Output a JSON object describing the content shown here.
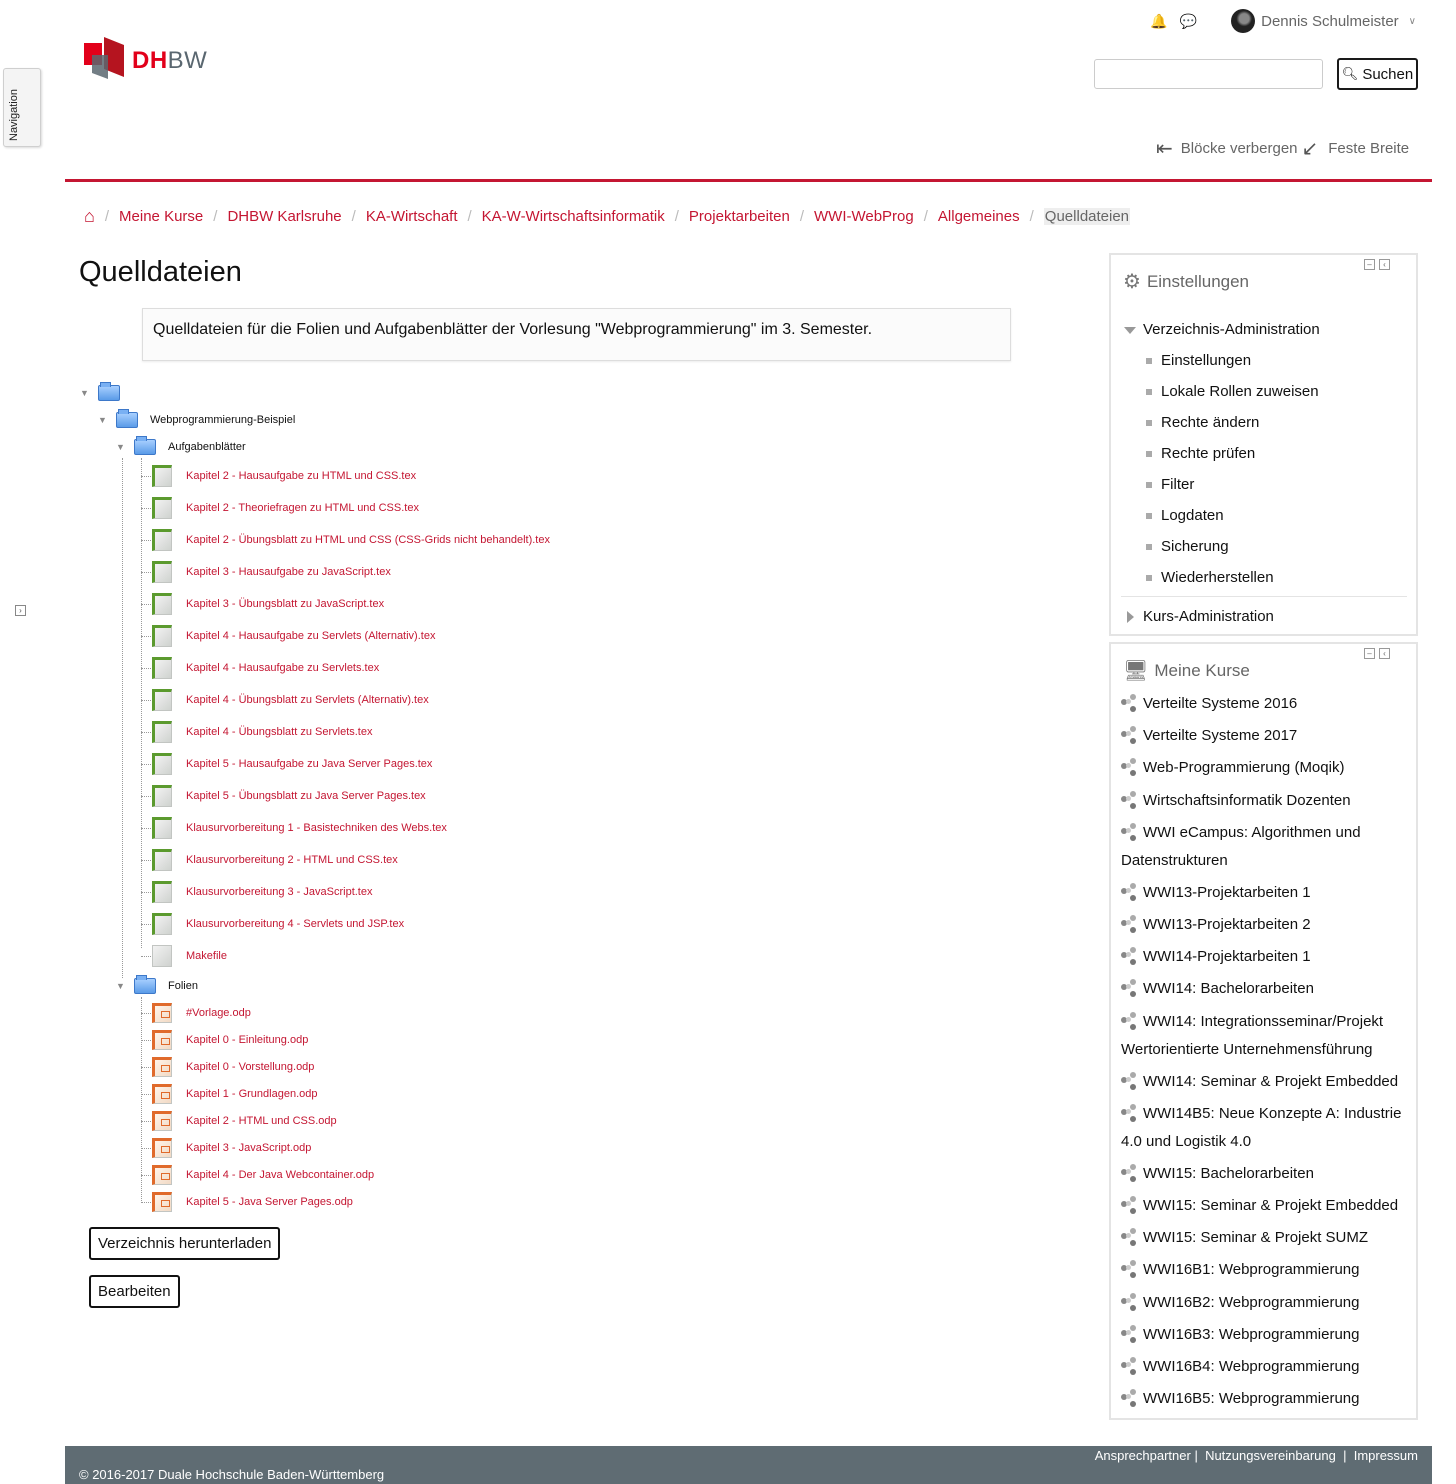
{
  "navigation_tab": {
    "label": "Navigation"
  },
  "logo": {
    "part1": "DH",
    "part2": "BW"
  },
  "topbar": {
    "notification_icon": "bell-icon",
    "messages_icon": "comments-icon",
    "user_name": "Dennis Schulmeister"
  },
  "search": {
    "placeholder": "",
    "button_label": "Suchen"
  },
  "header_tools": {
    "hide_blocks": "Blöcke verbergen",
    "fixed_width": "Feste Breite"
  },
  "breadcrumb": {
    "items": [
      "Meine Kurse",
      "DHBW Karlsruhe",
      "KA-Wirtschaft",
      "KA-W-Wirtschaftsinformatik",
      "Projektarbeiten",
      "WWI-WebProg",
      "Allgemeines"
    ],
    "current": "Quelldateien"
  },
  "page": {
    "title": "Quelldateien",
    "description": "Quelldateien für die Folien und Aufgabenblätter der Vorlesung \"Webprogrammierung\" im 3. Semester."
  },
  "tree": {
    "root_label": "",
    "folder1": "Webprogrammierung-Beispiel",
    "folder2": "Aufgabenblätter",
    "folder2_files": [
      "Kapitel 2 - Hausaufgabe zu HTML und CSS.tex",
      "Kapitel 2 - Theoriefragen zu HTML und CSS.tex",
      "Kapitel 2 - Übungsblatt zu HTML und CSS (CSS-Grids nicht behandelt).tex",
      "Kapitel 3 - Hausaufgabe zu JavaScript.tex",
      "Kapitel 3 - Übungsblatt zu JavaScript.tex",
      "Kapitel 4 - Hausaufgabe zu Servlets (Alternativ).tex",
      "Kapitel 4 - Hausaufgabe zu Servlets.tex",
      "Kapitel 4 - Übungsblatt zu Servlets (Alternativ).tex",
      "Kapitel 4 - Übungsblatt zu Servlets.tex",
      "Kapitel 5 - Hausaufgabe zu Java Server Pages.tex",
      "Kapitel 5 - Übungsblatt zu Java Server Pages.tex",
      "Klausurvorbereitung 1 - Basistechniken des Webs.tex",
      "Klausurvorbereitung 2 - HTML und CSS.tex",
      "Klausurvorbereitung 3 - JavaScript.tex",
      "Klausurvorbereitung 4 - Servlets und JSP.tex",
      "Makefile"
    ],
    "folder3": "Folien",
    "folder3_files": [
      "#Vorlage.odp",
      "Kapitel 0 - Einleitung.odp",
      "Kapitel 0 - Vorstellung.odp",
      "Kapitel 1 - Grundlagen.odp",
      "Kapitel 2 - HTML und CSS.odp",
      "Kapitel 3 - JavaScript.odp",
      "Kapitel 4 - Der Java Webcontainer.odp",
      "Kapitel 5 - Java Server Pages.odp"
    ]
  },
  "buttons": {
    "download": "Verzeichnis herunterladen",
    "edit": "Bearbeiten"
  },
  "settings_block": {
    "title": "Einstellungen",
    "icon": "gears-icon",
    "section1": "Verzeichnis-Administration",
    "section1_items": [
      "Einstellungen",
      "Lokale Rollen zuweisen",
      "Rechte ändern",
      "Rechte prüfen",
      "Filter",
      "Logdaten",
      "Sicherung",
      "Wiederherstellen"
    ],
    "section2": "Kurs-Administration"
  },
  "courses_block": {
    "title": "Meine Kurse",
    "icon": "desktop-icon",
    "courses": [
      "Verteilte Systeme 2016",
      "Verteilte Systeme 2017",
      "Web-Programmierung (Moqik)",
      "Wirtschaftsinformatik Dozenten",
      "WWI eCampus: Algorithmen und Datenstrukturen",
      "WWI13-Projektarbeiten 1",
      "WWI13-Projektarbeiten 2",
      "WWI14-Projektarbeiten 1",
      "WWI14: Bachelorarbeiten",
      "WWI14: Integrationsseminar/Projekt Wertorientierte Unternehmensführung",
      "WWI14: Seminar & Projekt Embedded",
      "WWI14B5: Neue Konzepte A: Industrie 4.0 und Logistik 4.0",
      "WWI15: Bachelorarbeiten",
      "WWI15: Seminar & Projekt Embedded",
      "WWI15: Seminar & Projekt SUMZ",
      "WWI16B1: Webprogrammierung",
      "WWI16B2: Webprogrammierung",
      "WWI16B3: Webprogrammierung",
      "WWI16B4: Webprogrammierung",
      "WWI16B5: Webprogrammierung"
    ]
  },
  "footer": {
    "links": [
      "Ansprechpartner",
      "Nutzungsvereinbarung",
      "Impressum"
    ],
    "copyright": "© 2016-2017 Duale Hochschule Baden-Württemberg"
  },
  "colors": {
    "accent": "#c41632",
    "footer_bg": "#5f6c73",
    "text": "#1a1a1a"
  }
}
